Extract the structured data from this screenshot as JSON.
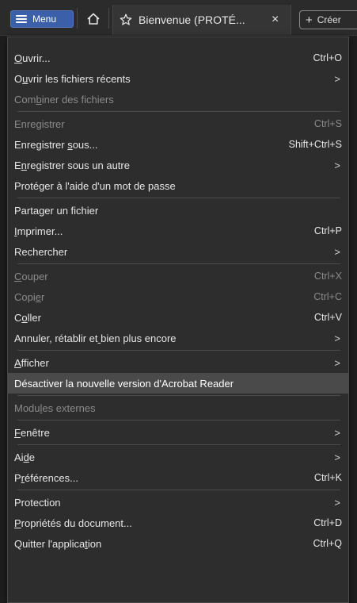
{
  "toolbar": {
    "menu_label": "Menu",
    "tab_title": "Bienvenue (PROTÉ...",
    "tab_close": "×",
    "create_label": "Créer"
  },
  "menu": {
    "groups": [
      [
        {
          "pre": "",
          "u": "O",
          "post": "uvrir...",
          "shortcut": "Ctrl+O",
          "submenu": false,
          "disabled": false
        },
        {
          "pre": "O",
          "u": "u",
          "post": "vrir les fichiers récents",
          "shortcut": "",
          "submenu": true,
          "disabled": false
        },
        {
          "pre": "Com",
          "u": "b",
          "post": "iner des fichiers",
          "shortcut": "",
          "submenu": false,
          "disabled": true
        }
      ],
      [
        {
          "pre": "Enregistrer",
          "u": "",
          "post": "",
          "shortcut": "Ctrl+S",
          "submenu": false,
          "disabled": true
        },
        {
          "pre": "Enregistrer ",
          "u": "s",
          "post": "ous...",
          "shortcut": "Shift+Ctrl+S",
          "submenu": false,
          "disabled": false
        },
        {
          "pre": "E",
          "u": "n",
          "post": "registrer sous un autre",
          "shortcut": "",
          "submenu": true,
          "disabled": false
        },
        {
          "pre": "Protéger à l'aide d'un mot de passe",
          "u": "",
          "post": "",
          "shortcut": "",
          "submenu": false,
          "disabled": false
        }
      ],
      [
        {
          "pre": "Partager un fichier",
          "u": "",
          "post": "",
          "shortcut": "",
          "submenu": false,
          "disabled": false
        },
        {
          "pre": "",
          "u": "I",
          "post": "mprimer...",
          "shortcut": "Ctrl+P",
          "submenu": false,
          "disabled": false
        },
        {
          "pre": "Rechercher",
          "u": "",
          "post": "",
          "shortcut": "",
          "submenu": true,
          "disabled": false
        }
      ],
      [
        {
          "pre": "",
          "u": "C",
          "post": "ouper",
          "shortcut": "Ctrl+X",
          "submenu": false,
          "disabled": true
        },
        {
          "pre": "Copi",
          "u": "e",
          "post": "r",
          "shortcut": "Ctrl+C",
          "submenu": false,
          "disabled": true
        },
        {
          "pre": "C",
          "u": "o",
          "post": "ller",
          "shortcut": "Ctrl+V",
          "submenu": false,
          "disabled": false
        },
        {
          "pre": "Annuler, rétablir et",
          "u": " ",
          "post": "bien plus encore",
          "shortcut": "",
          "submenu": true,
          "disabled": false
        }
      ],
      [
        {
          "pre": "",
          "u": "A",
          "post": "fficher",
          "shortcut": "",
          "submenu": true,
          "disabled": false
        },
        {
          "pre": "Désactiver la nouvelle version d'Acrobat Reader",
          "u": "",
          "post": "",
          "shortcut": "",
          "submenu": false,
          "disabled": false,
          "highlight": true
        }
      ],
      [
        {
          "pre": "Modu",
          "u": "l",
          "post": "es externes",
          "shortcut": "",
          "submenu": false,
          "disabled": true
        }
      ],
      [
        {
          "pre": "",
          "u": "F",
          "post": "enêtre",
          "shortcut": "",
          "submenu": true,
          "disabled": false
        }
      ],
      [
        {
          "pre": "Ai",
          "u": "d",
          "post": "e",
          "shortcut": "",
          "submenu": true,
          "disabled": false
        },
        {
          "pre": "P",
          "u": "r",
          "post": "éférences...",
          "shortcut": "Ctrl+K",
          "submenu": false,
          "disabled": false
        }
      ],
      [
        {
          "pre": "Protection",
          "u": "",
          "post": "",
          "shortcut": "",
          "submenu": true,
          "disabled": false
        },
        {
          "pre": "",
          "u": "P",
          "post": "ropriétés du document...",
          "shortcut": "Ctrl+D",
          "submenu": false,
          "disabled": false
        },
        {
          "pre": "Quitter l'applica",
          "u": "t",
          "post": "ion",
          "shortcut": "Ctrl+Q",
          "submenu": false,
          "disabled": false
        }
      ]
    ],
    "submenu_arrow": ">"
  },
  "colors": {
    "menu_button": "#3b5fa8",
    "panel_bg": "#2d2d2d",
    "highlight_bg": "#4a4a4a",
    "disabled_text": "#8a8a8a"
  },
  "icons": {
    "menu": "hamburger-icon",
    "home": "home-icon",
    "tab": "star-icon",
    "create": "plus-icon"
  }
}
